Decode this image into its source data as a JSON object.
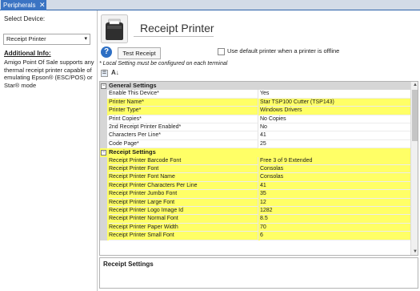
{
  "tab": {
    "label": "Peripherals",
    "close": "✕"
  },
  "left": {
    "select_label": "Select Device:",
    "device_value": "Receipt Printer",
    "addl_title": "Additional Info:",
    "addl_text": "Amigo Point Of Sale supports any thermal receipt printer capable of emulating Epson® (ESC/POS) or Star® mode"
  },
  "header": {
    "title": "Receipt Printer",
    "help": "?",
    "test_button": "Test Receipt",
    "default_checkbox_label": "Use default printer when a printer is offline",
    "local_note": "* Local Setting must be configured on each terminal"
  },
  "toolbar": {
    "categorized_icon": "categorized-icon",
    "sort_icon": "alphabetical-sort-icon",
    "sort_glyph": "A↓"
  },
  "highlight_color": "#ffff66",
  "grid": {
    "general_title": "General Settings",
    "general": [
      {
        "name": "Enable This Device*",
        "value": "Yes",
        "highlight": false
      },
      {
        "name": "Printer Name*",
        "value": "Star TSP100 Cutter (TSP143)",
        "highlight": true
      },
      {
        "name": "Printer Type*",
        "value": "Windows Drivers",
        "highlight": true
      },
      {
        "name": "Print Copies*",
        "value": "No Copies",
        "highlight": false
      },
      {
        "name": "2nd Receipt Printer Enabled*",
        "value": "No",
        "highlight": false
      },
      {
        "name": "Characters Per Line*",
        "value": "41",
        "highlight": false
      },
      {
        "name": "Code Page*",
        "value": "25",
        "highlight": false
      }
    ],
    "receipt_title": "Receipt Settings",
    "receipt": [
      {
        "name": "Receipt Printer Barcode Font",
        "value": "Free 3 of 9 Extended"
      },
      {
        "name": "Receipt Printer Font",
        "value": "Consolas"
      },
      {
        "name": "Receipt Printer Font Name",
        "value": "Consolas"
      },
      {
        "name": "Receipt Printer Characters Per Line",
        "value": "41"
      },
      {
        "name": "Receipt Printer Jumbo Font",
        "value": "35"
      },
      {
        "name": "Receipt Printer Large Font",
        "value": "12"
      },
      {
        "name": "Receipt Printer Logo Image  Id",
        "value": "1282"
      },
      {
        "name": "Receipt Printer Normal Font",
        "value": "8.5"
      },
      {
        "name": "Receipt Printer Paper Width",
        "value": "70"
      },
      {
        "name": "Receipt Printer Small Font",
        "value": "6"
      }
    ]
  },
  "description": {
    "title": "Receipt Settings"
  }
}
